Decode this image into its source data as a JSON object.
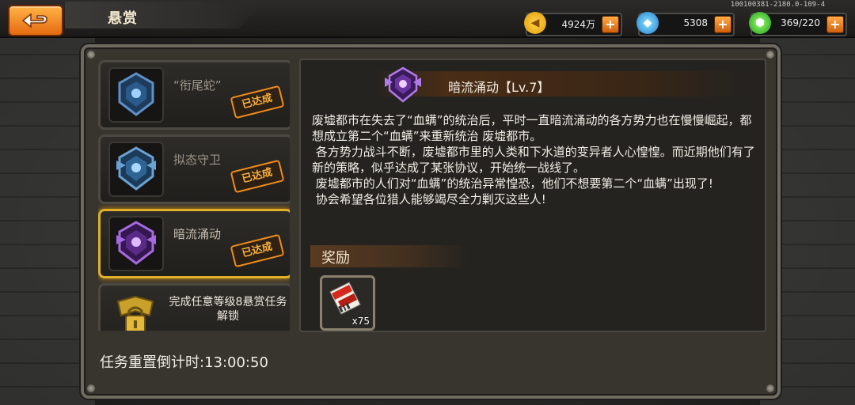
{
  "header": {
    "back_icon": "back-arrow-icon",
    "title": "悬赏",
    "version": "100100381-2180.0-109-4"
  },
  "resources": [
    {
      "icon": "gold-coin-icon",
      "value": "4924万",
      "color": "#f6b81d"
    },
    {
      "icon": "blue-gem-icon",
      "value": "5308",
      "color": "#35a8ee"
    },
    {
      "icon": "green-energy-icon",
      "value": "369/220",
      "color": "#3ec63a"
    }
  ],
  "missions": [
    {
      "name": "“衔尾蛇”",
      "status": "已达成",
      "emblem_color": "#3b7cc2",
      "selected": false
    },
    {
      "name": "拟态守卫",
      "status": "已达成",
      "emblem_color": "#4a8fc4",
      "selected": false
    },
    {
      "name": "暗流涌动",
      "status": "已达成",
      "emblem_color": "#8a46d0",
      "selected": true
    }
  ],
  "locked_mission": {
    "text": "完成任意等级8悬赏任务解锁",
    "icon": "lock-icon"
  },
  "reset_timer": "任务重置倒计时:13:00:50",
  "detail": {
    "title": "暗流涌动【Lv.7】",
    "emblem_icon": "purple-rank-emblem-icon",
    "description": "废墟都市在失去了“血螨”的统治后，平时一直暗流涌动的各方势力也在慢慢崛起，都想成立第二个“血螨”来重新统治 废墟都市。\n 各方势力战斗不断，废墟都市里的人类和下水道的变异者人心惶惶。而近期他们有了新的策略，似乎达成了某张协议，开始统一战线了。\n 废墟都市的人们对“血螨”的统治异常惶恐，他们不想要第二个“血螨”出现了!\n 协会希望各位猎人能够竭尽全力剿灭这些人!",
    "reward_title": "奖励",
    "rewards": [
      {
        "icon": "red-ticket-scroll-icon",
        "qty": "x75"
      }
    ]
  }
}
